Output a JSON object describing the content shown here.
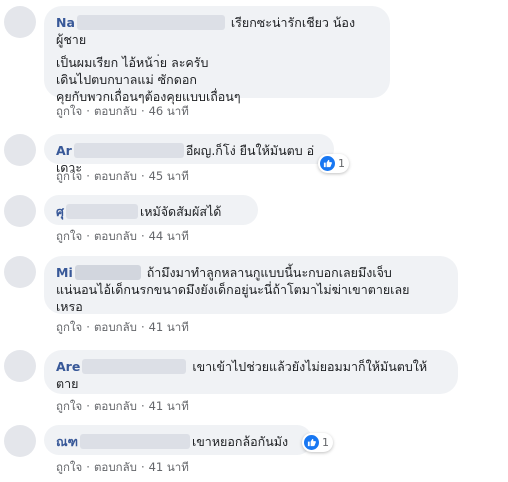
{
  "comments": [
    {
      "name": "Na",
      "text_line1": "เรียกซะน่ารักเชียว น้องผู้ชาย",
      "text_body": "เป็นผมเรียก ไอ้หน้า่ย ละครับ\nเดินไปตบกบาลแม่ ซักดอก\nคุยกับพวกเถื่อนๆต้องคุยแบบเถื่อนๆ",
      "like": "ถูกใจ",
      "reply": "ตอบกลับ",
      "time": "46 นาที"
    },
    {
      "name": "Ar",
      "text_line1": "อีผญ.ก็โง่ ยืนให้มันตบ อ่เดาะ",
      "like": "ถูกใจ",
      "reply": "ตอบกลับ",
      "time": "45 นาที",
      "reaction_count": "1"
    },
    {
      "name": "ศุ",
      "text_line1": "เหมัจัดสัมผัสได้",
      "like": "ถูกใจ",
      "reply": "ตอบกลับ",
      "time": "44 นาที"
    },
    {
      "name": "Mi",
      "text_line1": "ถ้ามึงมาทำลูกหลานกูแบบนี้นะกบอกเลยมึงเจ็บ",
      "text_body": "แน่นอนไอ้เด็กนรกขนาดมึงยังเด็กอยู่นะนี่ถ้าโตมาไม่ฆ่าเขาตายเลย\nเหรอ",
      "like": "ถูกใจ",
      "reply": "ตอบกลับ",
      "time": "41 นาที"
    },
    {
      "name": "Are",
      "text_line1": "เขาเข้าไปช่วยแล้วยังไม่ยอมมาก็ให้มันตบให้",
      "text_body": "ตาย",
      "like": "ถูกใจ",
      "reply": "ตอบกลับ",
      "time": "41 นาที"
    },
    {
      "name": "ณฑ",
      "text_line1": "เขาหยอกล้อกันมัง",
      "like": "ถูกใจ",
      "reply": "ตอบกลับ",
      "time": "41 นาที",
      "reaction_count": "1"
    }
  ],
  "colors": {
    "link": "#385898",
    "bubble": "#f0f2f5",
    "meta": "#65676b",
    "like": "#1877f2"
  },
  "icons": {
    "reaction": "like-icon"
  }
}
